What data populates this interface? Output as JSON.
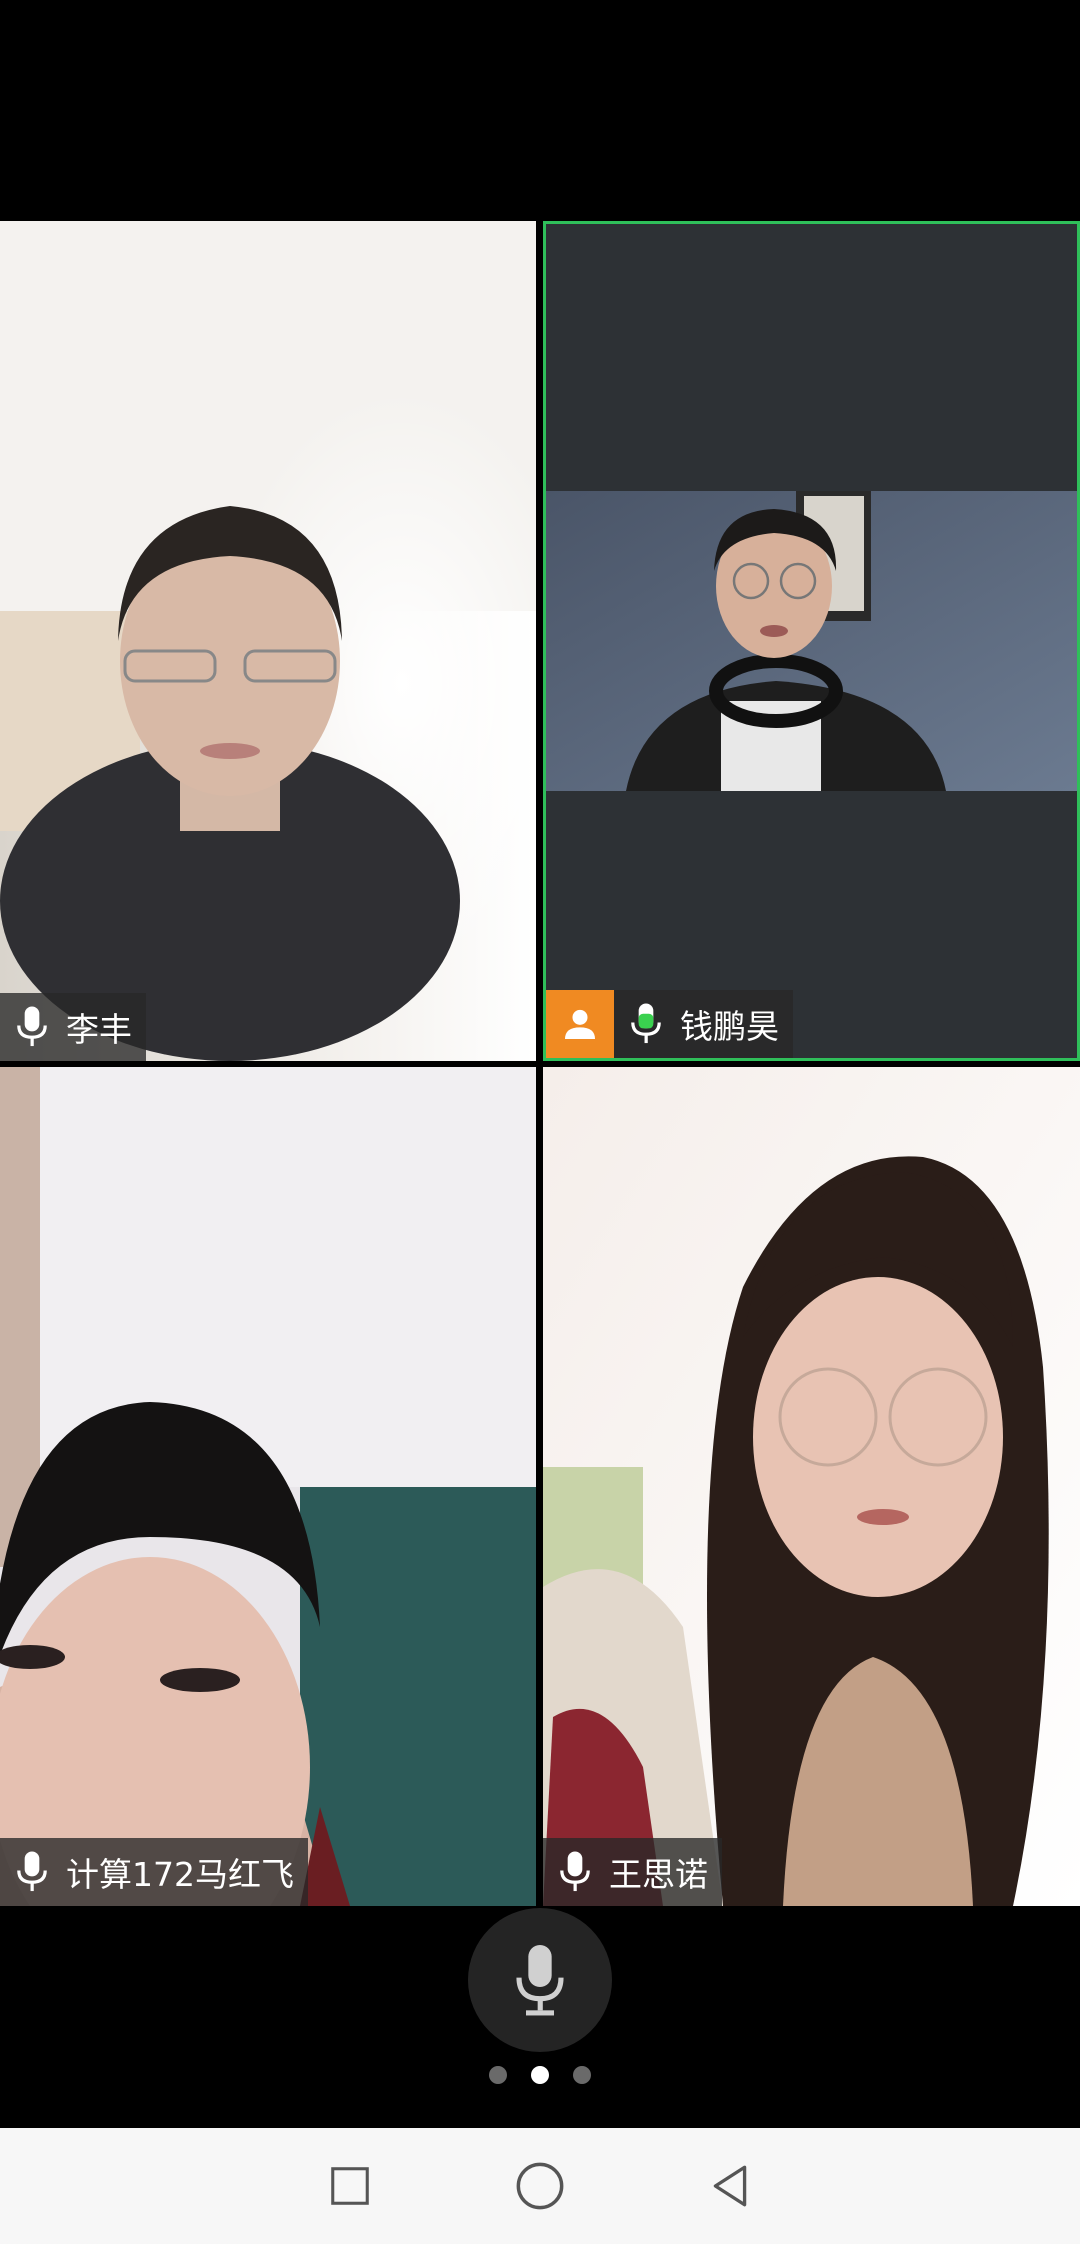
{
  "participants": [
    {
      "name": "李丰",
      "mic": "on"
    },
    {
      "name": "钱鹏昊",
      "mic": "speaking",
      "active": true
    },
    {
      "name": "计算172马红飞",
      "mic": "on"
    },
    {
      "name": "王思诺",
      "mic": "on"
    }
  ],
  "colors": {
    "active_border": "#2fbf5a",
    "avatar_badge": "#f08a22",
    "speaking_mic": "#3ad14f"
  },
  "pager": {
    "pages": 3,
    "current": 2
  },
  "icons": {
    "mic": "microphone-icon",
    "avatar": "person-icon",
    "nav_recent": "square-icon",
    "nav_home": "circle-icon",
    "nav_back": "triangle-back-icon"
  }
}
